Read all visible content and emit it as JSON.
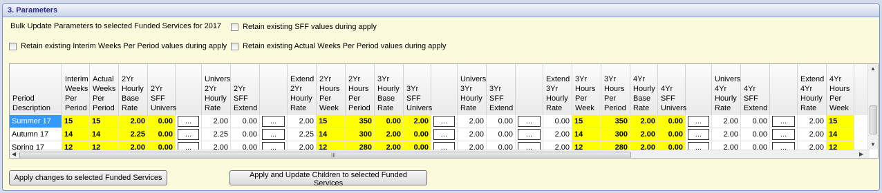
{
  "section": {
    "title": "3. Parameters"
  },
  "bulk_label": "Bulk Update Parameters to selected Funded Services for 2017",
  "checkboxes": {
    "retain_sff": "Retain existing SFF values during apply",
    "retain_interim": "Retain existing Interim Weeks Per Period values during apply",
    "retain_actual": "Retain existing Actual Weeks Per Period values during apply"
  },
  "columns": [
    "Period\nDescription",
    "Interim\nWeeks\nPer\nPeriod",
    "Actual\nWeeks\nPer\nPeriod",
    "2Yr\nHourly\nBase\nRate",
    "2Yr\nSFF\nUnivers",
    "",
    "Univers\n2Yr\nHourly\nRate",
    "2Yr\nSFF\nExtend",
    "",
    "Extend\n2Yr\nHourly\nRate",
    "2Yr\nHours\nPer\nWeek",
    "2Yr\nHours\nPer\nPeriod",
    "3Yr\nHourly\nBase\nRate",
    "3Yr\nSFF\nUnivers",
    "",
    "Univers\n3Yr\nHourly\nRate",
    "3Yr\nSFF\nExtend",
    "",
    "Extend\n3Yr\nHourly\nRate",
    "3Yr\nHours\nPer\nWeek",
    "3Yr\nHours\nPer\nPeriod",
    "4Yr\nHourly\nBase\nRate",
    "4Yr\nSFF\nUnivers",
    "",
    "Univers\n4Yr\nHourly\nRate",
    "4Yr\nSFF\nExtend",
    "",
    "Extend\n4Yr\nHourly\nRate",
    "4Yr\nHours\nPer\nWeek"
  ],
  "rows": [
    [
      "Summer 17",
      "15",
      "15",
      "2.00",
      "0.00",
      "...",
      "2.00",
      "0.00",
      "...",
      "2.00",
      "15",
      "350",
      "0.00",
      "2.00",
      "...",
      "2.00",
      "0.00",
      "...",
      "0.00",
      "15",
      "350",
      "2.00",
      "0.00",
      "...",
      "2.00",
      "0.00",
      "...",
      "2.00",
      "15"
    ],
    [
      "Autumn 17",
      "14",
      "14",
      "2.25",
      "0.00",
      "...",
      "2.25",
      "0.00",
      "...",
      "2.25",
      "14",
      "300",
      "2.00",
      "0.00",
      "...",
      "2.00",
      "0.00",
      "...",
      "2.00",
      "14",
      "300",
      "2.00",
      "0.00",
      "...",
      "2.00",
      "0.00",
      "...",
      "2.00",
      "14"
    ],
    [
      "Spring 17",
      "12",
      "12",
      "2.00",
      "0.00",
      "...",
      "2.00",
      "0.00",
      "...",
      "2.00",
      "12",
      "280",
      "2.00",
      "0.00",
      "...",
      "2.00",
      "0.00",
      "...",
      "2.00",
      "12",
      "280",
      "2.00",
      "0.00",
      "...",
      "2.00",
      "0.00",
      "...",
      "2.00",
      "12"
    ]
  ],
  "scroll_grip": "III",
  "buttons": {
    "apply": "Apply changes to selected Funded Services",
    "apply_update": "Apply and Update Children to selected Funded Services"
  },
  "colors": {
    "highlight": "#ffff00",
    "selection": "#3399ff",
    "panel": "#fcfadd",
    "title": "#2b2a8a"
  }
}
